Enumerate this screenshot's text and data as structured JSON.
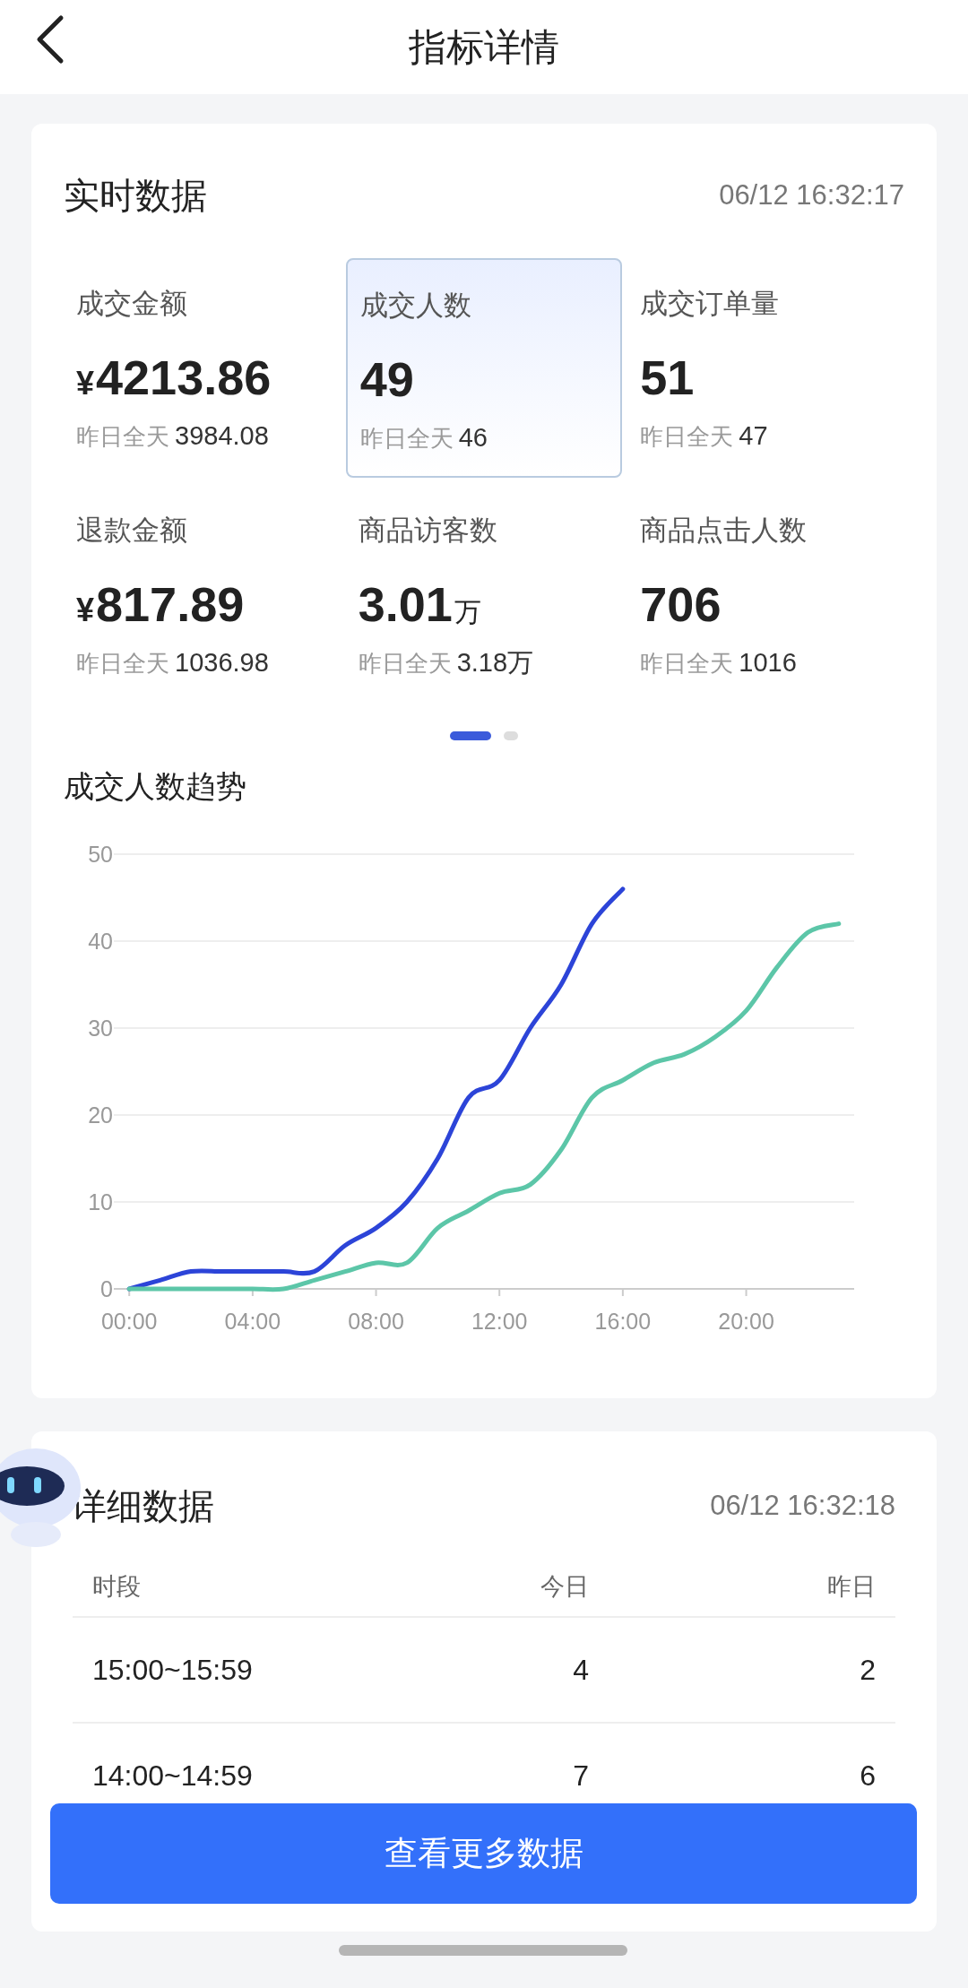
{
  "header": {
    "title": "指标详情"
  },
  "realtime": {
    "title": "实时数据",
    "time": "06/12 16:32:17",
    "metrics": [
      {
        "label": "成交金额",
        "prefix": "¥",
        "value": "4213.86",
        "yesterday_label": "昨日全天",
        "yesterday": "3984.08",
        "selected": false
      },
      {
        "label": "成交人数",
        "value": "49",
        "yesterday_label": "昨日全天",
        "yesterday": "46",
        "selected": true
      },
      {
        "label": "成交订单量",
        "value": "51",
        "yesterday_label": "昨日全天",
        "yesterday": "47",
        "selected": false
      },
      {
        "label": "退款金额",
        "prefix": "¥",
        "value": "817.89",
        "yesterday_label": "昨日全天",
        "yesterday": "1036.98",
        "selected": false
      },
      {
        "label": "商品访客数",
        "value": "3.01",
        "unit": "万",
        "yesterday_label": "昨日全天",
        "yesterday": "3.18万",
        "selected": false
      },
      {
        "label": "商品点击人数",
        "value": "706",
        "yesterday_label": "昨日全天",
        "yesterday": "1016",
        "selected": false
      }
    ],
    "pages": [
      {
        "selected": true
      },
      {
        "selected": false
      }
    ]
  },
  "trend": {
    "title": "成交人数趋势",
    "chart_data": {
      "type": "line",
      "x": [
        0,
        1,
        2,
        3,
        4,
        5,
        6,
        7,
        8,
        9,
        10,
        11,
        12,
        13,
        14,
        15,
        16,
        17,
        18,
        19,
        20,
        21,
        22,
        23
      ],
      "xticks": [
        {
          "value": 0,
          "label": "00:00"
        },
        {
          "value": 4,
          "label": "04:00"
        },
        {
          "value": 8,
          "label": "08:00"
        },
        {
          "value": 12,
          "label": "12:00"
        },
        {
          "value": 16,
          "label": "16:00"
        },
        {
          "value": 20,
          "label": "20:00"
        }
      ],
      "yticks": [
        0,
        10,
        20,
        30,
        40,
        50
      ],
      "ylim": [
        0,
        50
      ],
      "xlim": [
        -0.5,
        23.5
      ],
      "grid": true,
      "series": [
        {
          "color": "#2c44d8",
          "values": [
            0,
            1,
            2,
            2,
            2,
            2,
            2,
            5,
            7,
            10,
            15,
            22,
            24,
            30,
            35,
            42,
            46,
            null,
            null,
            null,
            null,
            null,
            null,
            null
          ]
        },
        {
          "color": "#5cc6a8",
          "values": [
            0,
            0,
            0,
            0,
            0,
            0,
            1,
            2,
            3,
            3,
            7,
            9,
            11,
            12,
            16,
            22,
            24,
            26,
            27,
            29,
            32,
            37,
            41,
            42
          ]
        }
      ]
    }
  },
  "detail": {
    "title": "详细数据",
    "time": "06/12 16:32:18",
    "columns": [
      "时段",
      "今日",
      "昨日"
    ],
    "rows": [
      [
        "15:00~15:59",
        "4",
        "2"
      ],
      [
        "14:00~14:59",
        "7",
        "6"
      ]
    ]
  },
  "more_button": "查看更多数据"
}
